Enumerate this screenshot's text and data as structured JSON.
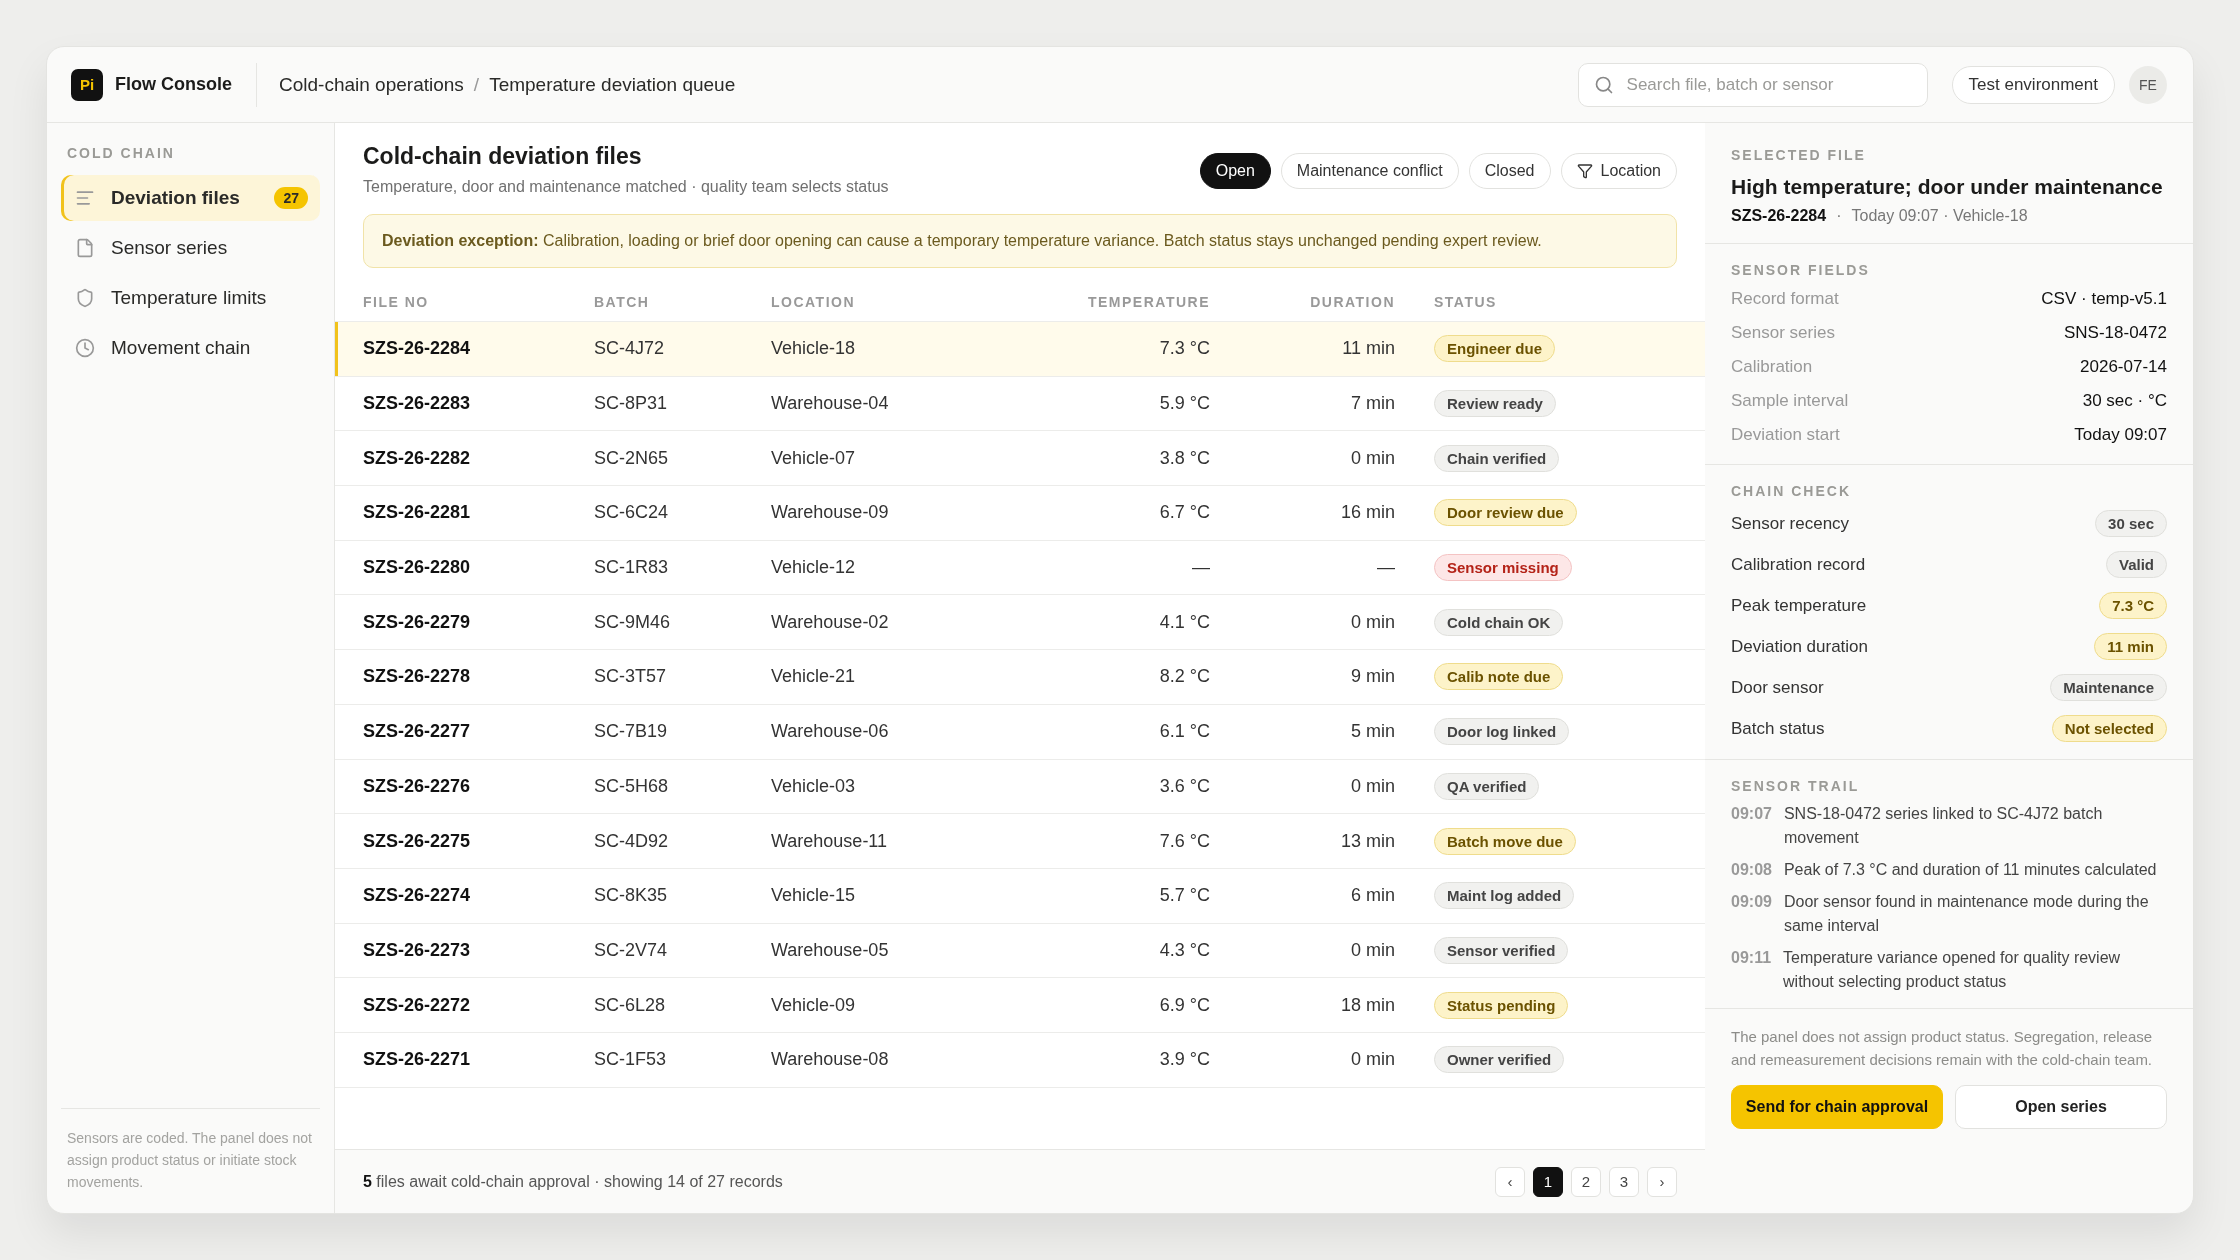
{
  "app": {
    "logo": "Pi",
    "name": "Flow Console"
  },
  "breadcrumb": [
    "Cold-chain operations",
    "/",
    "Temperature deviation queue"
  ],
  "search": {
    "placeholder": "Search file, batch or sensor"
  },
  "environment": "Test environment",
  "avatar": "FE",
  "sidebar": {
    "heading": "COLD CHAIN",
    "items": [
      {
        "label": "Deviation files",
        "count": "27",
        "selected": true
      },
      {
        "label": "Sensor series",
        "selected": false
      },
      {
        "label": "Temperature limits",
        "selected": false
      },
      {
        "label": "Movement chain",
        "selected": false
      }
    ],
    "note": "Sensors are coded. The panel does not assign product status or initiate stock movements."
  },
  "main": {
    "title": "Cold-chain deviation files",
    "subtitle": "Temperature, door and maintenance matched · quality team selects status",
    "filters": [
      {
        "label": "Open",
        "selected": true
      },
      {
        "label": "Maintenance conflict",
        "selected": false
      },
      {
        "label": "Closed",
        "selected": false
      },
      {
        "label": "Location",
        "selected": false,
        "kind": "filter"
      }
    ],
    "alert": {
      "label": "Deviation exception:",
      "text": "Calibration, loading or brief door opening can cause a temporary temperature variance. Batch status stays unchanged pending expert review."
    }
  },
  "table": {
    "columns": [
      "FILE NO",
      "BATCH",
      "LOCATION",
      "TEMPERATURE",
      "DURATION",
      "STATUS"
    ],
    "rows": [
      {
        "file": "SZS-26-2284",
        "batch": "SC-4J72",
        "location": "Vehicle-18",
        "temperature": "7.3 °C",
        "duration": "11 min",
        "status": "Engineer due",
        "kind": "warn",
        "selected": true
      },
      {
        "file": "SZS-26-2283",
        "batch": "SC-8P31",
        "location": "Warehouse-04",
        "temperature": "5.9 °C",
        "duration": "7 min",
        "status": "Review ready",
        "kind": "neutral",
        "selected": false
      },
      {
        "file": "SZS-26-2282",
        "batch": "SC-2N65",
        "location": "Vehicle-07",
        "temperature": "3.8 °C",
        "duration": "0 min",
        "status": "Chain verified",
        "kind": "neutral",
        "selected": false
      },
      {
        "file": "SZS-26-2281",
        "batch": "SC-6C24",
        "location": "Warehouse-09",
        "temperature": "6.7 °C",
        "duration": "16 min",
        "status": "Door review due",
        "kind": "warn",
        "selected": false
      },
      {
        "file": "SZS-26-2280",
        "batch": "SC-1R83",
        "location": "Vehicle-12",
        "temperature": "—",
        "duration": "—",
        "status": "Sensor missing",
        "kind": "error",
        "selected": false
      },
      {
        "file": "SZS-26-2279",
        "batch": "SC-9M46",
        "location": "Warehouse-02",
        "temperature": "4.1 °C",
        "duration": "0 min",
        "status": "Cold chain OK",
        "kind": "neutral",
        "selected": false
      },
      {
        "file": "SZS-26-2278",
        "batch": "SC-3T57",
        "location": "Vehicle-21",
        "temperature": "8.2 °C",
        "duration": "9 min",
        "status": "Calib note due",
        "kind": "warn",
        "selected": false
      },
      {
        "file": "SZS-26-2277",
        "batch": "SC-7B19",
        "location": "Warehouse-06",
        "temperature": "6.1 °C",
        "duration": "5 min",
        "status": "Door log linked",
        "kind": "neutral",
        "selected": false
      },
      {
        "file": "SZS-26-2276",
        "batch": "SC-5H68",
        "location": "Vehicle-03",
        "temperature": "3.6 °C",
        "duration": "0 min",
        "status": "QA verified",
        "kind": "neutral",
        "selected": false
      },
      {
        "file": "SZS-26-2275",
        "batch": "SC-4D92",
        "location": "Warehouse-11",
        "temperature": "7.6 °C",
        "duration": "13 min",
        "status": "Batch move due",
        "kind": "warn",
        "selected": false
      },
      {
        "file": "SZS-26-2274",
        "batch": "SC-8K35",
        "location": "Vehicle-15",
        "temperature": "5.7 °C",
        "duration": "6 min",
        "status": "Maint log added",
        "kind": "neutral",
        "selected": false
      },
      {
        "file": "SZS-26-2273",
        "batch": "SC-2V74",
        "location": "Warehouse-05",
        "temperature": "4.3 °C",
        "duration": "0 min",
        "status": "Sensor verified",
        "kind": "neutral",
        "selected": false
      },
      {
        "file": "SZS-26-2272",
        "batch": "SC-6L28",
        "location": "Vehicle-09",
        "temperature": "6.9 °C",
        "duration": "18 min",
        "status": "Status pending",
        "kind": "warn",
        "selected": false
      },
      {
        "file": "SZS-26-2271",
        "batch": "SC-1F53",
        "location": "Warehouse-08",
        "temperature": "3.9 °C",
        "duration": "0 min",
        "status": "Owner verified",
        "kind": "neutral",
        "selected": false
      }
    ]
  },
  "footer": {
    "summary": "**5** files await cold-chain approval · showing 14 of 27 records",
    "pages": [
      {
        "label": "‹",
        "selected": false
      },
      {
        "label": "1",
        "selected": true
      },
      {
        "label": "2",
        "selected": false
      },
      {
        "label": "3",
        "selected": false
      },
      {
        "label": "›",
        "selected": false
      }
    ]
  },
  "detail": {
    "heading": "SELECTED FILE",
    "title": "High temperature; door under maintenance",
    "file": "SZS-26-2284",
    "sep": "·",
    "meta": "Today 09:07 · Vehicle-18",
    "fields_heading": "SENSOR FIELDS",
    "fields": [
      {
        "label": "Record format",
        "value": "CSV · temp-v5.1"
      },
      {
        "label": "Sensor series",
        "value": "SNS-18-0472"
      },
      {
        "label": "Calibration",
        "value": "2026-07-14"
      },
      {
        "label": "Sample interval",
        "value": "30 sec · °C"
      },
      {
        "label": "Deviation start",
        "value": "Today 09:07"
      }
    ],
    "check_heading": "CHAIN CHECK",
    "checks": [
      {
        "label": "Sensor recency",
        "value": "30 sec",
        "kind": "neutral"
      },
      {
        "label": "Calibration record",
        "value": "Valid",
        "kind": "neutral"
      },
      {
        "label": "Peak temperature",
        "value": "7.3 °C",
        "kind": "warn"
      },
      {
        "label": "Deviation duration",
        "value": "11 min",
        "kind": "warn"
      },
      {
        "label": "Door sensor",
        "value": "Maintenance",
        "kind": "neutral"
      },
      {
        "label": "Batch status",
        "value": "Not selected",
        "kind": "warn"
      }
    ],
    "trail_heading": "SENSOR TRAIL",
    "trail": [
      {
        "time": "09:07",
        "text": "SNS-18-0472 series linked to SC-4J72 batch movement"
      },
      {
        "time": "09:08",
        "text": "Peak of 7.3 °C and duration of 11 minutes calculated"
      },
      {
        "time": "09:09",
        "text": "Door sensor found in maintenance mode during the same interval"
      },
      {
        "time": "09:11",
        "text": "Temperature variance opened for quality review without selecting product status"
      }
    ],
    "note": "The panel does not assign product status. Segregation, release and remeasurement decisions remain with the cold-chain team.",
    "actions": [
      {
        "label": "Send for chain approval",
        "kind": "primary"
      },
      {
        "label": "Open series",
        "kind": "secondary"
      }
    ]
  }
}
